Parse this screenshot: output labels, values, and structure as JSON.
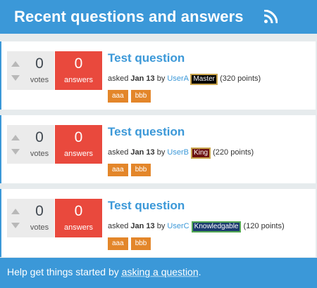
{
  "header": {
    "title": "Recent questions and answers",
    "rss_icon": "rss-feed-icon"
  },
  "questions": [
    {
      "votes": "0",
      "votes_label": "votes",
      "answers": "0",
      "answers_label": "answers",
      "title": "Test question",
      "asked": "asked",
      "when": "Jan 13",
      "by": "by",
      "user": "UserA",
      "badge": "Master",
      "points": "(320 points)",
      "badge_bg": "#000000",
      "badge_fg": "#ffffff",
      "badge_border": "#c8a34b",
      "tags": [
        "aaa",
        "bbb"
      ]
    },
    {
      "votes": "0",
      "votes_label": "votes",
      "answers": "0",
      "answers_label": "answers",
      "title": "Test question",
      "asked": "asked",
      "when": "Jan 13",
      "by": "by",
      "user": "UserB",
      "badge": "King",
      "points": "(220 points)",
      "badge_bg": "#6b1010",
      "badge_fg": "#ffffff",
      "badge_border": "#c8a34b",
      "tags": [
        "aaa",
        "bbb"
      ]
    },
    {
      "votes": "0",
      "votes_label": "votes",
      "answers": "0",
      "answers_label": "answers",
      "title": "Test question",
      "asked": "asked",
      "when": "Jan 13",
      "by": "by",
      "user": "UserC",
      "badge": "Knowledgable",
      "points": "(120 points)",
      "badge_bg": "#1a3a6e",
      "badge_fg": "#ffffff",
      "badge_border": "#55aa55",
      "tags": [
        "aaa",
        "bbb"
      ]
    }
  ],
  "footer": {
    "text": "Help get things started by ",
    "link": "asking a question",
    "end": "."
  },
  "colors": {
    "primary": "#3b98d8",
    "answers_bg": "#e9493d",
    "tag_bg": "#e3862a"
  }
}
